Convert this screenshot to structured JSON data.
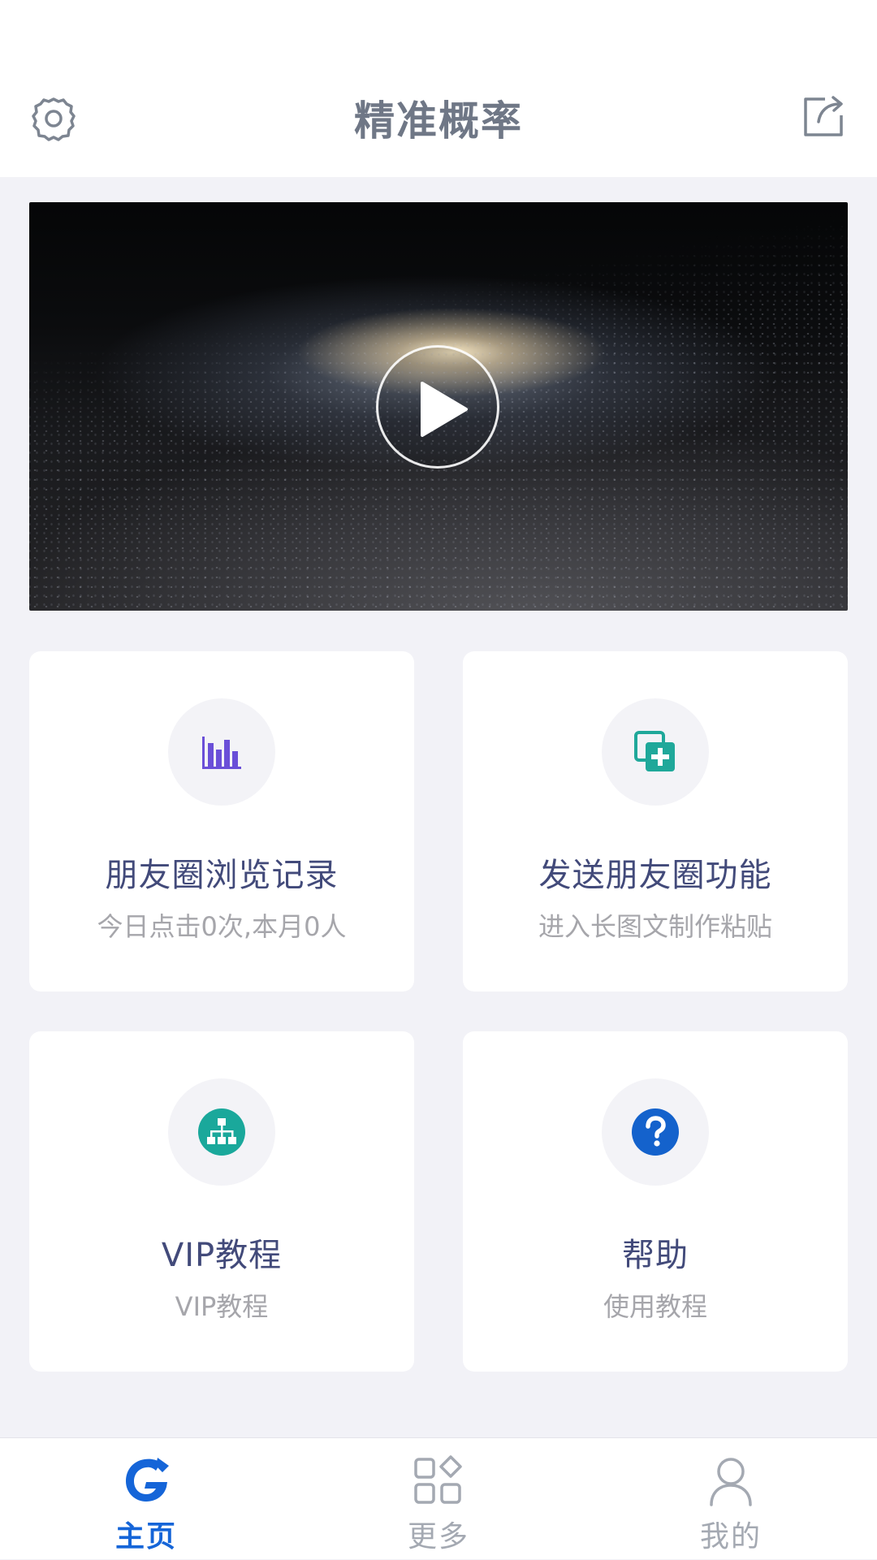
{
  "header": {
    "title": "精准概率",
    "left_icon": "gear-icon",
    "right_icon": "share-icon"
  },
  "video": {
    "icon": "play-icon"
  },
  "cards": [
    {
      "title": "朋友圈浏览记录",
      "subtitle": "今日点击0次,本月0人",
      "icon": "bar-chart-icon",
      "icon_color": "#6a4fd8"
    },
    {
      "title": "发送朋友圈功能",
      "subtitle": "进入长图文制作粘贴",
      "icon": "copy-add-icon",
      "icon_color": "#1fa89a"
    },
    {
      "title": "VIP教程",
      "subtitle": "VIP教程",
      "icon": "org-chart-icon",
      "icon_color": "#1aa89b"
    },
    {
      "title": "帮助",
      "subtitle": "使用教程",
      "icon": "question-icon",
      "icon_color": "#1462cc"
    }
  ],
  "tabbar": {
    "items": [
      {
        "label": "主页",
        "icon": "home-logo-icon",
        "active": true
      },
      {
        "label": "更多",
        "icon": "grid-icon",
        "active": false
      },
      {
        "label": "我的",
        "icon": "user-icon",
        "active": false
      }
    ],
    "active_color": "#1565d8",
    "inactive_color": "#a4a9b2"
  }
}
